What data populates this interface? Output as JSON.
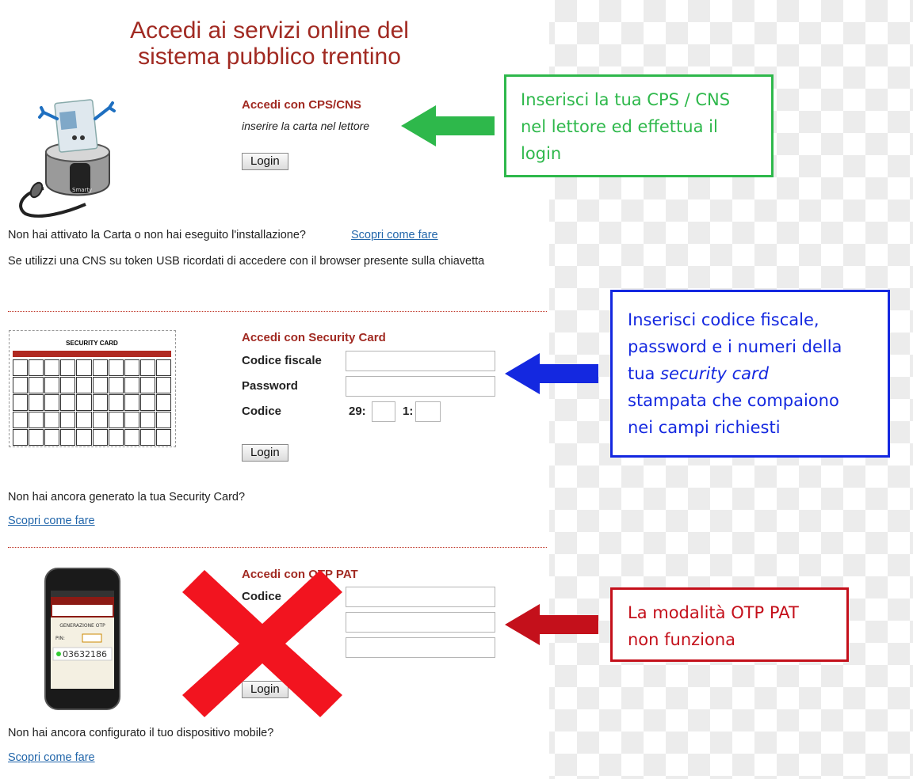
{
  "page": {
    "title_line1": "Accedi ai servizi online del",
    "title_line2": "sistema pubblico trentino"
  },
  "cps": {
    "heading": "Accedi con CPS/CNS",
    "instruction": "inserire la carta nel lettore",
    "login_label": "Login",
    "reader_label": "Smarty",
    "not_activated_text": "Non hai attivato la Carta o non hai eseguito l'installazione?",
    "not_activated_link": "Scopri come fare",
    "usb_note": "Se utilizzi una CNS su token USB ricordati di accedere con il browser presente sulla chiavetta"
  },
  "security_card": {
    "heading": "Accedi con Security Card",
    "image_title": "SECURITY CARD",
    "codice_fiscale_label": "Codice fiscale",
    "password_label": "Password",
    "codice_label": "Codice",
    "code_index_1": "29:",
    "code_index_2": "1:",
    "login_label": "Login",
    "not_generated_text": "Non hai ancora generato la tua Security Card?",
    "not_generated_link": "Scopri come fare"
  },
  "otp": {
    "heading": "Accedi con OTP PAT",
    "codice_label": "Codice",
    "login_label": "Login",
    "phone_screen_title": "GENERAZIONE OTP",
    "phone_pin_label": "PIN:",
    "phone_otp_value": "03632186",
    "not_configured_text": "Non hai ancora configurato il tuo dispositivo mobile?",
    "not_configured_link": "Scopri come fare"
  },
  "callouts": {
    "green": {
      "text": "Inserisci la tua CPS / CNS nel lettore ed effettua il login",
      "color": "#2eb84b"
    },
    "blue": {
      "line1": "Inserisci codice fiscale,",
      "line2": "password e i numeri della",
      "line3_prefix": "tua ",
      "line3_italic": "security card",
      "line4": "stampata che compaiono",
      "line5": "nei campi richiesti",
      "color": "#1428e0"
    },
    "red": {
      "text": "La modalità OTP PAT non funziona",
      "color": "#c4101b"
    }
  },
  "colors": {
    "heading_red": "#a12a22",
    "link_blue": "#2266aa",
    "cross_red": "#f2141f"
  },
  "icons": [
    "card-reader-icon",
    "security-card-image",
    "smartphone-image",
    "cross-mark-icon",
    "arrow-left-icon"
  ]
}
